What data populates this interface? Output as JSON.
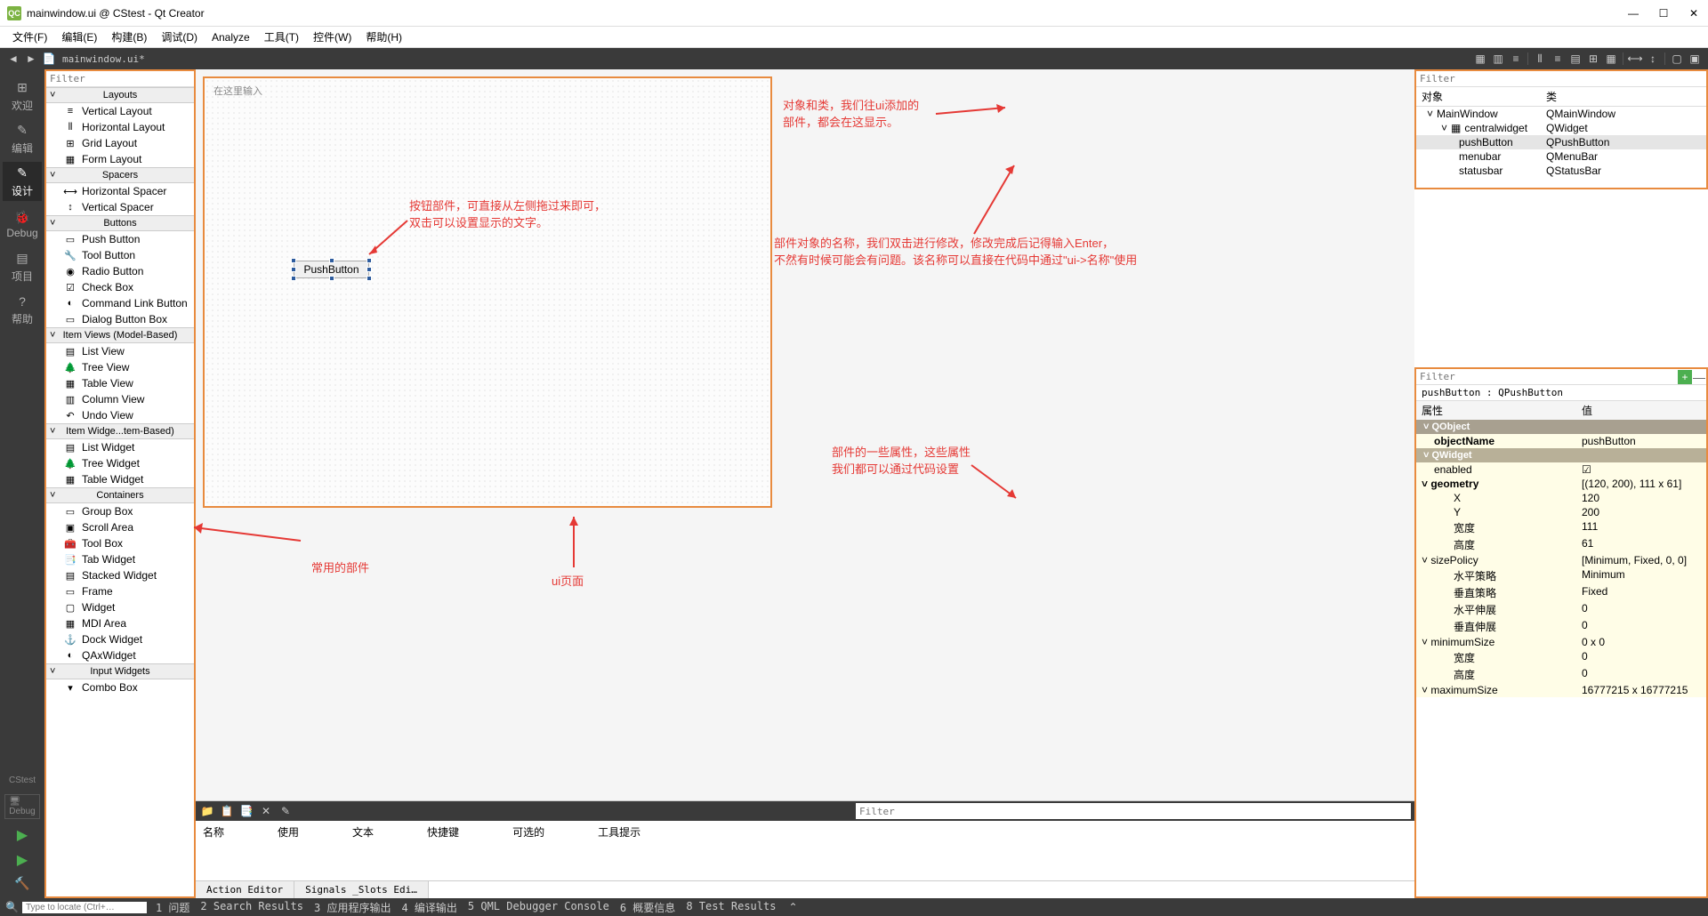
{
  "title": "mainwindow.ui @ CStest - Qt Creator",
  "menu": [
    "文件(F)",
    "编辑(E)",
    "构建(B)",
    "调试(D)",
    "Analyze",
    "工具(T)",
    "控件(W)",
    "帮助(H)"
  ],
  "filename": "mainwindow.ui*",
  "side_buttons": [
    {
      "icon": "⊞",
      "label": "欢迎"
    },
    {
      "icon": "✎",
      "label": "编辑"
    },
    {
      "icon": "✎",
      "label": "设计",
      "active": true
    },
    {
      "icon": "🐞",
      "label": "Debug"
    },
    {
      "icon": "▤",
      "label": "项目"
    },
    {
      "icon": "?",
      "label": "帮助"
    }
  ],
  "side_tag": "CStest",
  "side_debug": "Debug",
  "widget_filter_placeholder": "Filter",
  "widget_sections": [
    {
      "title": "Layouts",
      "items": [
        {
          "ico": "≡",
          "label": "Vertical Layout"
        },
        {
          "ico": "⦀",
          "label": "Horizontal Layout"
        },
        {
          "ico": "⊞",
          "label": "Grid Layout"
        },
        {
          "ico": "▦",
          "label": "Form Layout"
        }
      ]
    },
    {
      "title": "Spacers",
      "items": [
        {
          "ico": "⟷",
          "label": "Horizontal Spacer"
        },
        {
          "ico": "↕",
          "label": "Vertical Spacer"
        }
      ]
    },
    {
      "title": "Buttons",
      "items": [
        {
          "ico": "▭",
          "label": "Push Button"
        },
        {
          "ico": "🔧",
          "label": "Tool Button"
        },
        {
          "ico": "◉",
          "label": "Radio Button"
        },
        {
          "ico": "☑",
          "label": "Check Box"
        },
        {
          "ico": "◐",
          "label": "Command Link Button"
        },
        {
          "ico": "▭",
          "label": "Dialog Button Box"
        }
      ]
    },
    {
      "title": "Item Views (Model-Based)",
      "items": [
        {
          "ico": "▤",
          "label": "List View"
        },
        {
          "ico": "🌲",
          "label": "Tree View"
        },
        {
          "ico": "▦",
          "label": "Table View"
        },
        {
          "ico": "▥",
          "label": "Column View"
        },
        {
          "ico": "↶",
          "label": "Undo View"
        }
      ]
    },
    {
      "title": "Item Widge...tem-Based)",
      "items": [
        {
          "ico": "▤",
          "label": "List Widget"
        },
        {
          "ico": "🌲",
          "label": "Tree Widget"
        },
        {
          "ico": "▦",
          "label": "Table Widget"
        }
      ]
    },
    {
      "title": "Containers",
      "items": [
        {
          "ico": "▭",
          "label": "Group Box"
        },
        {
          "ico": "▣",
          "label": "Scroll Area"
        },
        {
          "ico": "🧰",
          "label": "Tool Box"
        },
        {
          "ico": "📑",
          "label": "Tab Widget"
        },
        {
          "ico": "▤",
          "label": "Stacked Widget"
        },
        {
          "ico": "▭",
          "label": "Frame"
        },
        {
          "ico": "▢",
          "label": "Widget"
        },
        {
          "ico": "▦",
          "label": "MDI Area"
        },
        {
          "ico": "⚓",
          "label": "Dock Widget"
        },
        {
          "ico": "◐",
          "label": "QAxWidget"
        }
      ]
    },
    {
      "title": "Input Widgets",
      "items": [
        {
          "ico": "▾",
          "label": "Combo Box"
        }
      ]
    }
  ],
  "canvas_placeholder": "在这里输入",
  "pushbutton_text": "PushButton",
  "bottom_filter_placeholder": "Filter",
  "bottom_headers": [
    "名称",
    "使用",
    "文本",
    "快捷键",
    "可选的",
    "工具提示"
  ],
  "bottom_tabs": [
    "Action Editor",
    "Signals _Slots Edi…"
  ],
  "obj_tree": {
    "filter_placeholder": "Filter",
    "headers": [
      "对象",
      "类"
    ],
    "rows": [
      {
        "indent": 0,
        "name": "MainWindow",
        "cls": "QMainWindow",
        "exp": "˅"
      },
      {
        "indent": 1,
        "name": "centralwidget",
        "cls": "QWidget",
        "exp": "˅",
        "ico": "▦"
      },
      {
        "indent": 2,
        "name": "pushButton",
        "cls": "QPushButton",
        "sel": true
      },
      {
        "indent": 2,
        "name": "menubar",
        "cls": "QMenuBar"
      },
      {
        "indent": 2,
        "name": "statusbar",
        "cls": "QStatusBar"
      }
    ]
  },
  "prop": {
    "filter_placeholder": "Filter",
    "label": "pushButton : QPushButton",
    "headers": [
      "属性",
      "值"
    ],
    "sections": [
      {
        "name": "QObject",
        "cls": "obj",
        "rows": [
          {
            "k": "objectName",
            "v": "pushButton",
            "bold": true
          }
        ]
      },
      {
        "name": "QWidget",
        "cls": "wid",
        "rows": [
          {
            "k": "enabled",
            "v": "☑"
          },
          {
            "k": "geometry",
            "v": "[(120, 200), 111 x 61]",
            "exp": true,
            "bold": true
          },
          {
            "k": "X",
            "v": "120",
            "sub": true
          },
          {
            "k": "Y",
            "v": "200",
            "sub": true
          },
          {
            "k": "宽度",
            "v": "111",
            "sub": true
          },
          {
            "k": "高度",
            "v": "61",
            "sub": true
          },
          {
            "k": "sizePolicy",
            "v": "[Minimum, Fixed, 0, 0]",
            "exp": true
          },
          {
            "k": "水平策略",
            "v": "Minimum",
            "sub": true
          },
          {
            "k": "垂直策略",
            "v": "Fixed",
            "sub": true
          },
          {
            "k": "水平伸展",
            "v": "0",
            "sub": true
          },
          {
            "k": "垂直伸展",
            "v": "0",
            "sub": true
          },
          {
            "k": "minimumSize",
            "v": "0 x 0",
            "exp": true
          },
          {
            "k": "宽度",
            "v": "0",
            "sub": true
          },
          {
            "k": "高度",
            "v": "0",
            "sub": true
          },
          {
            "k": "maximumSize",
            "v": "16777215 x 16777215",
            "exp": true
          }
        ]
      }
    ]
  },
  "annotations": {
    "a1": "按钮部件，可直接从左侧拖过来即可，\n双击可以设置显示的文字。",
    "a2": "对象和类，我们往ui添加的\n部件，都会在这显示。",
    "a3": "部件对象的名称，我们双击进行修改，修改完成后记得输入Enter，\n不然有时候可能会有问题。该名称可以直接在代码中通过\"ui->名称\"使用",
    "a4": "部件的一些属性，这些属性\n我们都可以通过代码设置",
    "a5": "常用的部件",
    "a6": "ui页面"
  },
  "status": {
    "search_placeholder": "Type to locate (Ctrl+…",
    "items": [
      "1 问题",
      "2 Search Results",
      "3 应用程序输出",
      "4 编译输出",
      "5 QML Debugger Console",
      "6 概要信息",
      "8 Test Results"
    ]
  }
}
